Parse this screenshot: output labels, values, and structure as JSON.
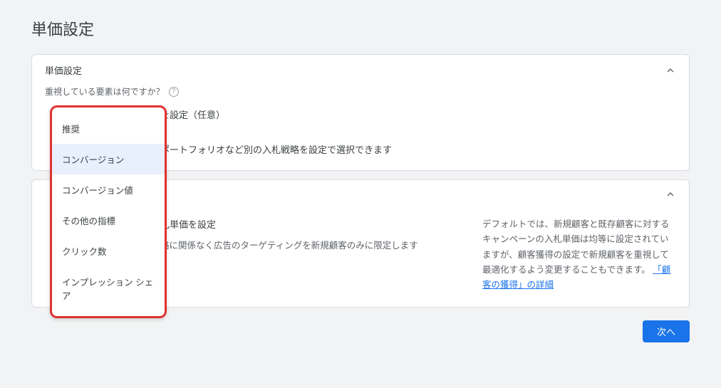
{
  "page": {
    "title": "単価設定"
  },
  "panel1": {
    "header": "単価設定",
    "question": "重視している要素は何ですか？",
    "line1_suffix": "を設定（任意）",
    "line2_suffix": "ポートフォリオなど別の入札戦略を設定で選択できます"
  },
  "dropdown": {
    "items": [
      {
        "label": "推奨"
      },
      {
        "label": "コンバージョン"
      },
      {
        "label": "コンバージョン値"
      },
      {
        "label": "その他の指標"
      },
      {
        "label": "クリック数"
      },
      {
        "label": "インプレッション シェア"
      }
    ],
    "selected_index": 1
  },
  "panel2": {
    "left_title": "札単価を設定",
    "left_sub": "略に関係なく広告のターゲティングを新規顧客のみに限定します",
    "right_text": "デフォルトでは、新規顧客と既存顧客に対するキャンペーンの入札単価は均等に設定されていますが、顧客獲得の設定で新規顧客を重視して最適化するよう変更することもできます。",
    "right_link": "「顧客の獲得」の詳細"
  },
  "footer": {
    "next": "次へ"
  }
}
